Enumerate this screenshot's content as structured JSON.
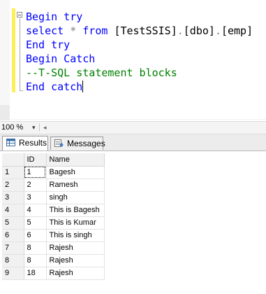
{
  "editor": {
    "lines": [
      [
        {
          "t": "Begin try",
          "c": "kw"
        }
      ],
      [
        {
          "t": "select ",
          "c": "kw"
        },
        {
          "t": "* ",
          "c": "op"
        },
        {
          "t": "from ",
          "c": "kw"
        },
        {
          "t": "[TestSSIS]",
          "c": "tx"
        },
        {
          "t": ".",
          "c": "op"
        },
        {
          "t": "[dbo]",
          "c": "tx"
        },
        {
          "t": ".",
          "c": "op"
        },
        {
          "t": "[emp]",
          "c": "tx"
        }
      ],
      [
        {
          "t": "End try",
          "c": "kw"
        }
      ],
      [
        {
          "t": "Begin Catch",
          "c": "kw"
        }
      ],
      [
        {
          "t": "--T-SQL statement blocks",
          "c": "cm"
        }
      ],
      [
        {
          "t": "End catch",
          "c": "kw"
        }
      ]
    ],
    "colors": {
      "keyword": "#0000ff",
      "operator": "#808080",
      "comment": "#008000",
      "change_bar": "#ffee5a"
    }
  },
  "zoom": {
    "value": "100 %"
  },
  "tabs": [
    {
      "label": "Results",
      "icon": "grid-icon",
      "active": true
    },
    {
      "label": "Messages",
      "icon": "messages-icon",
      "active": false
    }
  ],
  "grid": {
    "columns": [
      "ID",
      "Name"
    ],
    "rows": [
      {
        "num": "1",
        "id": "1",
        "name": "Bagesh"
      },
      {
        "num": "2",
        "id": "2",
        "name": "Ramesh"
      },
      {
        "num": "3",
        "id": "3",
        "name": "singh"
      },
      {
        "num": "4",
        "id": "4",
        "name": "This is Bagesh"
      },
      {
        "num": "5",
        "id": "5",
        "name": "This is Kumar"
      },
      {
        "num": "6",
        "id": "6",
        "name": "This is singh"
      },
      {
        "num": "7",
        "id": "8",
        "name": "Rajesh"
      },
      {
        "num": "8",
        "id": "8",
        "name": "Rajesh"
      },
      {
        "num": "9",
        "id": "18",
        "name": "Rajesh"
      }
    ]
  }
}
